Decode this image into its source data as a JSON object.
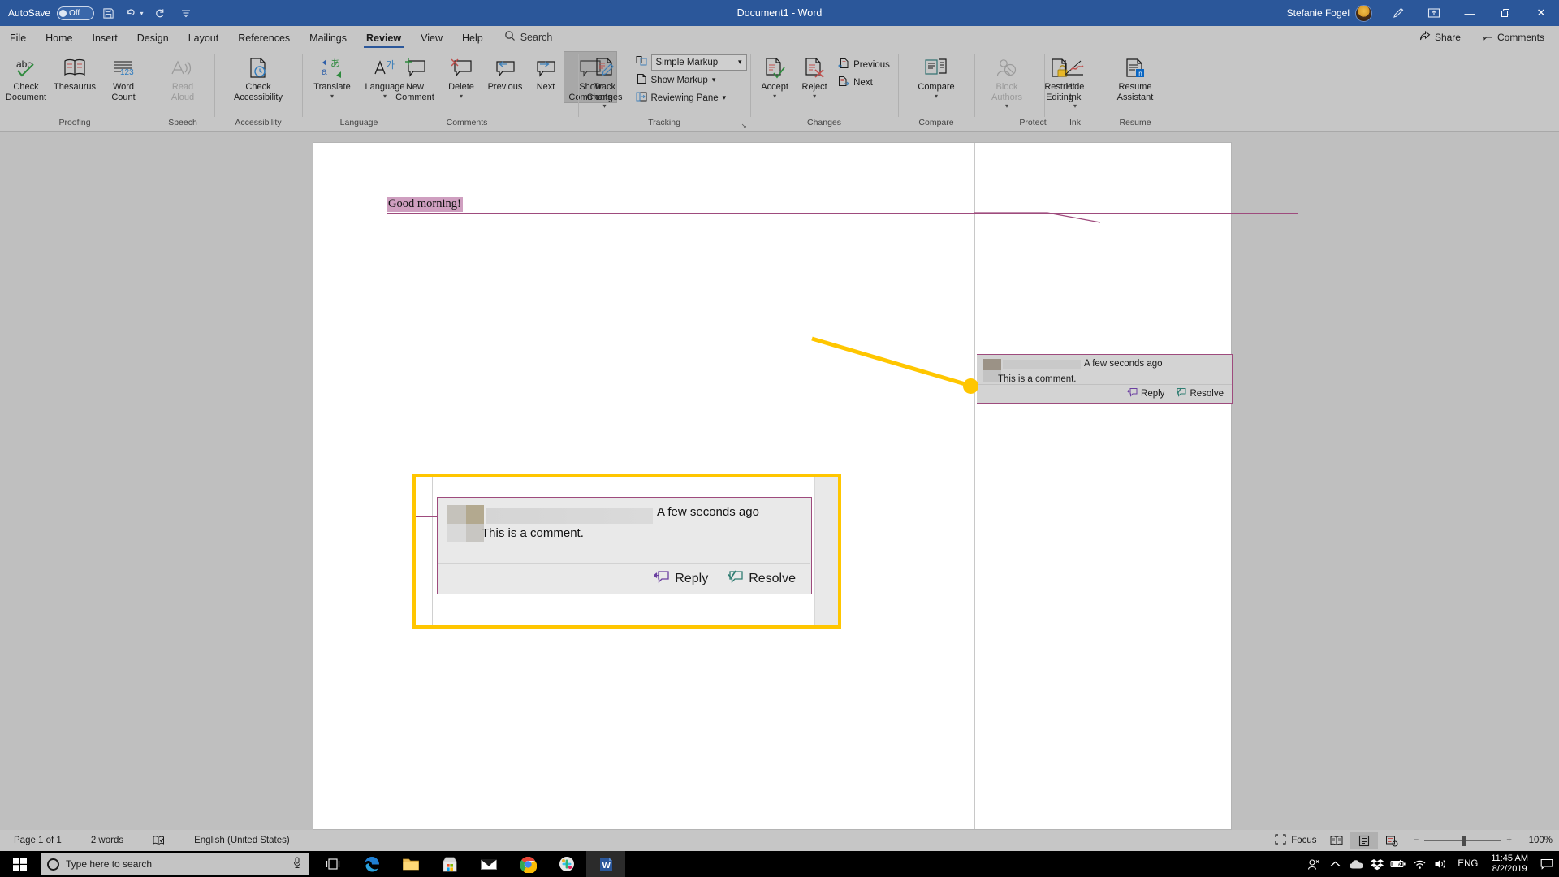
{
  "titlebar": {
    "autosave_label": "AutoSave",
    "autosave_state": "Off",
    "save_icon": "save-icon",
    "undo_icon": "undo-icon",
    "redo_icon": "redo-icon",
    "customize_icon": "customize-quick-access-icon",
    "document_title": "Document1  -  Word",
    "user_name": "Stefanie Fogel",
    "pen_icon": "ink-pen-icon",
    "ribbon_display_icon": "ribbon-display-options-icon",
    "minimize": "—",
    "restore": "❐",
    "close": "✕"
  },
  "tabs": [
    {
      "label": "File",
      "active": false
    },
    {
      "label": "Home",
      "active": false
    },
    {
      "label": "Insert",
      "active": false
    },
    {
      "label": "Design",
      "active": false
    },
    {
      "label": "Layout",
      "active": false
    },
    {
      "label": "References",
      "active": false
    },
    {
      "label": "Mailings",
      "active": false
    },
    {
      "label": "Review",
      "active": true
    },
    {
      "label": "View",
      "active": false
    },
    {
      "label": "Help",
      "active": false
    }
  ],
  "search": {
    "placeholder": "Search",
    "label": "Search",
    "icon": "search-icon"
  },
  "tab_actions": [
    {
      "label": "Share",
      "icon": "share-icon"
    },
    {
      "label": "Comments",
      "icon": "comments-icon"
    }
  ],
  "ribbon": {
    "groups": [
      {
        "name": "Proofing",
        "buttons": [
          {
            "label": "Check\nDocument",
            "line1": "Check",
            "line2": "Document",
            "icon": "spelling-check-icon",
            "disabled": false,
            "caret": false
          },
          {
            "label": "Thesaurus",
            "line1": "Thesaurus",
            "line2": "",
            "icon": "thesaurus-icon",
            "disabled": false,
            "caret": false
          },
          {
            "label": "Word Count",
            "line1": "Word",
            "line2": "Count",
            "icon": "word-count-icon",
            "disabled": false,
            "caret": false
          }
        ]
      },
      {
        "name": "Speech",
        "buttons": [
          {
            "label": "Read Aloud",
            "line1": "Read",
            "line2": "Aloud",
            "icon": "read-aloud-icon",
            "disabled": true,
            "caret": false
          }
        ]
      },
      {
        "name": "Accessibility",
        "buttons": [
          {
            "label": "Check Accessibility",
            "line1": "Check",
            "line2": "Accessibility",
            "icon": "check-accessibility-icon",
            "disabled": false,
            "caret": false
          }
        ]
      },
      {
        "name": "Language",
        "buttons": [
          {
            "label": "Translate",
            "line1": "Translate",
            "line2": "",
            "icon": "translate-icon",
            "disabled": false,
            "caret": true
          },
          {
            "label": "Language",
            "line1": "Language",
            "line2": "",
            "icon": "language-icon",
            "disabled": false,
            "caret": true
          }
        ]
      },
      {
        "name": "Comments",
        "buttons": [
          {
            "label": "New Comment",
            "line1": "New",
            "line2": "Comment",
            "icon": "new-comment-icon",
            "disabled": false,
            "caret": false
          },
          {
            "label": "Delete",
            "line1": "Delete",
            "line2": "",
            "icon": "delete-comment-icon",
            "disabled": false,
            "caret": true
          },
          {
            "label": "Previous",
            "line1": "Previous",
            "line2": "",
            "icon": "previous-comment-icon",
            "disabled": false,
            "caret": false
          },
          {
            "label": "Next",
            "line1": "Next",
            "line2": "",
            "icon": "next-comment-icon",
            "disabled": false,
            "caret": false
          },
          {
            "label": "Show Comments",
            "line1": "Show",
            "line2": "Comments",
            "icon": "show-comments-icon",
            "disabled": false,
            "caret": false,
            "active": true
          }
        ]
      },
      {
        "name": "Tracking",
        "buttons": [
          {
            "label": "Track Changes",
            "line1": "Track",
            "line2": "Changes",
            "icon": "track-changes-icon",
            "disabled": false,
            "caret": true
          }
        ],
        "dropdowns": [
          {
            "label": "Simple Markup",
            "icon": "markup-view-icon",
            "boxed": true
          },
          {
            "label": "Show Markup",
            "icon": "show-markup-icon",
            "boxed": false
          },
          {
            "label": "Reviewing Pane",
            "icon": "reviewing-pane-icon",
            "boxed": false
          }
        ],
        "launcher": "↘"
      },
      {
        "name": "Changes",
        "buttons": [
          {
            "label": "Accept",
            "line1": "Accept",
            "line2": "",
            "icon": "accept-change-icon",
            "disabled": false,
            "caret": true
          },
          {
            "label": "Reject",
            "line1": "Reject",
            "line2": "",
            "icon": "reject-change-icon",
            "disabled": false,
            "caret": true
          }
        ],
        "small": [
          {
            "label": "Previous",
            "icon": "previous-change-icon"
          },
          {
            "label": "Next",
            "icon": "next-change-icon"
          }
        ]
      },
      {
        "name": "Compare",
        "buttons": [
          {
            "label": "Compare",
            "line1": "Compare",
            "line2": "",
            "icon": "compare-documents-icon",
            "disabled": false,
            "caret": true
          }
        ]
      },
      {
        "name": "Protect",
        "buttons": [
          {
            "label": "Block Authors",
            "line1": "Block",
            "line2": "Authors",
            "icon": "block-authors-icon",
            "disabled": true,
            "caret": true
          },
          {
            "label": "Restrict Editing",
            "line1": "Restrict",
            "line2": "Editing",
            "icon": "restrict-editing-icon",
            "disabled": false,
            "caret": false
          }
        ]
      },
      {
        "name": "Ink",
        "buttons": [
          {
            "label": "Hide Ink",
            "line1": "Hide",
            "line2": "Ink",
            "icon": "hide-ink-icon",
            "disabled": false,
            "caret": true
          }
        ]
      },
      {
        "name": "Resume",
        "buttons": [
          {
            "label": "Resume Assistant",
            "line1": "Resume",
            "line2": "Assistant",
            "icon": "resume-assistant-icon",
            "disabled": false,
            "caret": false
          }
        ]
      }
    ]
  },
  "document": {
    "body_text": "Good morning!",
    "highlight_color": "#cf9fc0",
    "comment_line_color": "#9e4b7d"
  },
  "comment": {
    "author_redacted": true,
    "timestamp": "A few seconds ago",
    "text": "This is a comment.",
    "reply_label": "Reply",
    "resolve_label": "Resolve",
    "reply_icon": "reply-comment-icon",
    "resolve_icon": "resolve-comment-icon"
  },
  "callout": {
    "border_color": "#ffc600",
    "timestamp": "A few seconds ago",
    "text": "This is a comment.",
    "reply_label": "Reply",
    "resolve_label": "Resolve"
  },
  "statusbar": {
    "page": "Page 1 of 1",
    "words": "2 words",
    "proofing_icon": "proofing-status-icon",
    "language": "English (United States)",
    "focus_label": "Focus",
    "focus_icon": "focus-mode-icon",
    "view_read_icon": "read-mode-icon",
    "view_print_icon": "print-layout-icon",
    "view_web_icon": "web-layout-icon",
    "zoom_out": "−",
    "zoom_in": "+",
    "zoom_level": "100%"
  },
  "taskbar": {
    "start_icon": "windows-start-icon",
    "search_placeholder": "Type here to search",
    "search_icon": "cortana-circle-icon",
    "mic_icon": "microphone-icon",
    "task_view_icon": "task-view-icon",
    "apps": [
      {
        "name": "edge-icon",
        "running": false
      },
      {
        "name": "file-explorer-icon",
        "running": false
      },
      {
        "name": "microsoft-store-icon",
        "running": false
      },
      {
        "name": "mail-icon",
        "running": false
      },
      {
        "name": "chrome-icon",
        "running": true
      },
      {
        "name": "slack-icon",
        "running": true
      },
      {
        "name": "word-icon",
        "running": true
      }
    ],
    "tray": {
      "people_icon": "people-icon",
      "chevron_icon": "show-hidden-icons-icon",
      "onedrive_icon": "onedrive-icon",
      "dropbox_icon": "dropbox-icon",
      "battery_icon": "battery-icon",
      "wifi_icon": "wifi-icon",
      "volume_icon": "volume-icon",
      "language": "ENG",
      "time": "11:45 AM",
      "date": "8/2/2019",
      "action_center_icon": "action-center-icon"
    }
  }
}
